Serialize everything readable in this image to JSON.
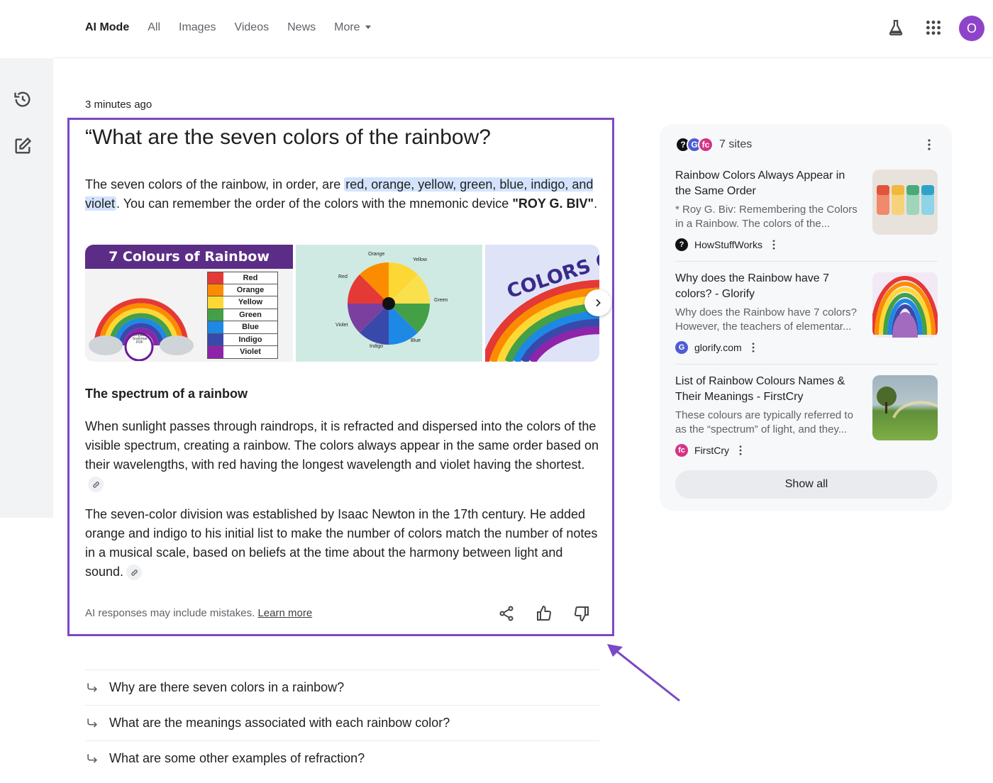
{
  "header": {
    "tabs": [
      {
        "label": "AI Mode",
        "active": true
      },
      {
        "label": "All"
      },
      {
        "label": "Images"
      },
      {
        "label": "Videos"
      },
      {
        "label": "News"
      },
      {
        "label": "More"
      }
    ],
    "avatar_letter": "O",
    "icons": [
      "labs-flask-icon",
      "apps-grid-icon"
    ]
  },
  "rail": {
    "icons": [
      "history-icon",
      "new-chat-icon"
    ]
  },
  "main": {
    "timestamp": "3 minutes ago",
    "question": "“What are the seven colors of the rainbow?",
    "answer": {
      "intro": "The seven colors of the rainbow, in order, are ",
      "highlight": "red, orange, yellow, green, blue, indigo, and violet",
      "middle": ". You can remember the order of the colors with the mnemonic device ",
      "mnemonic": "\"ROY G. BIV\"",
      "end": "."
    },
    "images": {
      "card1_title": "7 Colours of Rainbow",
      "card1_colors": [
        "Red",
        "Orange",
        "Yellow",
        "Green",
        "Blue",
        "Indigo",
        "Violet"
      ],
      "card1_badge": "English Grammar PDF",
      "card2_labels": [
        "Orange",
        "Yellow",
        "Red",
        "Green",
        "Violet",
        "Indigo",
        "Blue"
      ],
      "card3_text": "COLORS O"
    },
    "section_heading": "The spectrum of a rainbow",
    "para1": "When sunlight passes through raindrops, it is refracted and dispersed into the colors of the visible spectrum, creating a rainbow. The colors always appear in the same order based on their wavelengths, with red having the longest wavelength and violet having the shortest.",
    "para2": "The seven-color division was established by Isaac Newton in the 17th century. He added orange and indigo to his initial list to make the number of colors match the number of notes in a musical scale, based on beliefs at the time about the harmony between light and sound.",
    "footer_note": "AI responses may include mistakes.",
    "footer_link": "Learn more",
    "followups": [
      "Why are there seven colors in a rainbow?",
      "What are the meanings associated with each rainbow color?",
      "What are some other examples of refraction?"
    ],
    "accent_color": "#7c48c6"
  },
  "sources": {
    "count_label": "7 sites",
    "items": [
      {
        "title": "Rainbow Colors Always Appear in the Same Order",
        "snippet": "* Roy G. Biv: Remembering the Colors in a Rainbow. The colors of the...",
        "site": "HowStuffWorks"
      },
      {
        "title": "Why does the Rainbow have 7 colors? - Glorify",
        "snippet": "Why does the Rainbow have 7 colors? However, the teachers of elementar...",
        "site": "glorify.com"
      },
      {
        "title": "List of Rainbow Colours Names & Their Meanings - FirstCry",
        "snippet": "These colours are typically referred to as the “spectrum” of light, and they...",
        "site": "FirstCry"
      }
    ],
    "show_all": "Show all"
  }
}
